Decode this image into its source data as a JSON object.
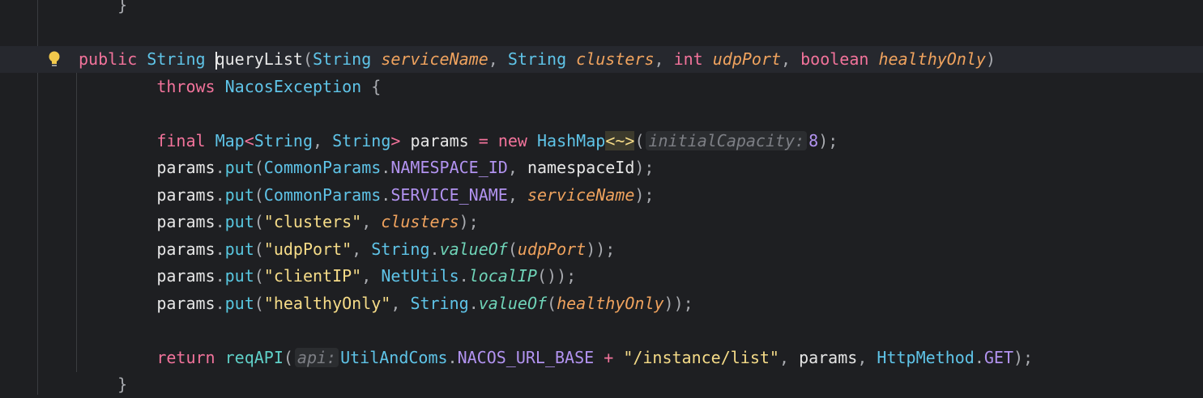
{
  "editor": {
    "language": "java",
    "colors": {
      "background": "#1e1f22",
      "current_line": "#26282e",
      "keyword": "#f2739b",
      "type": "#5fc4e8",
      "string": "#f6dc88",
      "parameter": "#f0a35e",
      "constant": "#b293f0"
    },
    "gutter_icon": "lightbulb-icon",
    "lines": [
      {
        "indent": "    ",
        "tokens": [
          {
            "t": "}",
            "c": "punct"
          }
        ]
      },
      {
        "indent": "",
        "tokens": []
      },
      {
        "indent": "",
        "current": true,
        "bulb": true,
        "tokens": [
          {
            "t": "public",
            "c": "kw"
          },
          {
            "t": " "
          },
          {
            "t": "String",
            "c": "type"
          },
          {
            "t": " "
          },
          {
            "t": "queryList",
            "c": "plain",
            "caret": true
          },
          {
            "t": "(",
            "c": "punct"
          },
          {
            "t": "String",
            "c": "type"
          },
          {
            "t": " "
          },
          {
            "t": "serviceName",
            "c": "param"
          },
          {
            "t": ", ",
            "c": "punct"
          },
          {
            "t": "String",
            "c": "type"
          },
          {
            "t": " "
          },
          {
            "t": "clusters",
            "c": "param"
          },
          {
            "t": ", ",
            "c": "punct"
          },
          {
            "t": "int",
            "c": "kw"
          },
          {
            "t": " "
          },
          {
            "t": "udpPort",
            "c": "param"
          },
          {
            "t": ", ",
            "c": "punct"
          },
          {
            "t": "boolean",
            "c": "kw"
          },
          {
            "t": " "
          },
          {
            "t": "healthyOnly",
            "c": "param"
          },
          {
            "t": ")",
            "c": "punct"
          }
        ]
      },
      {
        "indent": "        ",
        "tokens": [
          {
            "t": "throws",
            "c": "kw"
          },
          {
            "t": " "
          },
          {
            "t": "NacosException",
            "c": "type"
          },
          {
            "t": " "
          },
          {
            "t": "{",
            "c": "punct"
          }
        ]
      },
      {
        "indent": "",
        "tokens": []
      },
      {
        "indent": "        ",
        "tokens": [
          {
            "t": "final",
            "c": "kw"
          },
          {
            "t": " "
          },
          {
            "t": "Map",
            "c": "type"
          },
          {
            "t": "<",
            "c": "kw"
          },
          {
            "t": "String",
            "c": "type"
          },
          {
            "t": ", ",
            "c": "punct"
          },
          {
            "t": "String",
            "c": "type"
          },
          {
            "t": ">",
            "c": "kw"
          },
          {
            "t": " "
          },
          {
            "t": "params",
            "c": "plain"
          },
          {
            "t": " "
          },
          {
            "t": "=",
            "c": "kw"
          },
          {
            "t": " "
          },
          {
            "t": "new",
            "c": "kw"
          },
          {
            "t": " "
          },
          {
            "t": "HashMap",
            "c": "type"
          },
          {
            "t": "<~>",
            "c": "angle"
          },
          {
            "t": "(",
            "c": "punct"
          },
          {
            "t": "initialCapacity:",
            "c": "hint"
          },
          {
            "t": "8",
            "c": "num"
          },
          {
            "t": ");",
            "c": "punct"
          }
        ]
      },
      {
        "indent": "        ",
        "tokens": [
          {
            "t": "params",
            "c": "plain"
          },
          {
            "t": ".",
            "c": "punct"
          },
          {
            "t": "put",
            "c": "method"
          },
          {
            "t": "(",
            "c": "punct"
          },
          {
            "t": "CommonParams",
            "c": "type"
          },
          {
            "t": ".",
            "c": "punct"
          },
          {
            "t": "NAMESPACE_ID",
            "c": "const"
          },
          {
            "t": ", ",
            "c": "punct"
          },
          {
            "t": "namespaceId",
            "c": "plain"
          },
          {
            "t": ");",
            "c": "punct"
          }
        ]
      },
      {
        "indent": "        ",
        "tokens": [
          {
            "t": "params",
            "c": "plain"
          },
          {
            "t": ".",
            "c": "punct"
          },
          {
            "t": "put",
            "c": "method"
          },
          {
            "t": "(",
            "c": "punct"
          },
          {
            "t": "CommonParams",
            "c": "type"
          },
          {
            "t": ".",
            "c": "punct"
          },
          {
            "t": "SERVICE_NAME",
            "c": "const"
          },
          {
            "t": ", ",
            "c": "punct"
          },
          {
            "t": "serviceName",
            "c": "param"
          },
          {
            "t": ");",
            "c": "punct"
          }
        ]
      },
      {
        "indent": "        ",
        "tokens": [
          {
            "t": "params",
            "c": "plain"
          },
          {
            "t": ".",
            "c": "punct"
          },
          {
            "t": "put",
            "c": "method"
          },
          {
            "t": "(",
            "c": "punct"
          },
          {
            "t": "\"clusters\"",
            "c": "str"
          },
          {
            "t": ", ",
            "c": "punct"
          },
          {
            "t": "clusters",
            "c": "param"
          },
          {
            "t": ");",
            "c": "punct"
          }
        ]
      },
      {
        "indent": "        ",
        "tokens": [
          {
            "t": "params",
            "c": "plain"
          },
          {
            "t": ".",
            "c": "punct"
          },
          {
            "t": "put",
            "c": "method"
          },
          {
            "t": "(",
            "c": "punct"
          },
          {
            "t": "\"udpPort\"",
            "c": "str"
          },
          {
            "t": ", ",
            "c": "punct"
          },
          {
            "t": "String",
            "c": "type"
          },
          {
            "t": ".",
            "c": "punct"
          },
          {
            "t": "valueOf",
            "c": "static"
          },
          {
            "t": "(",
            "c": "punct"
          },
          {
            "t": "udpPort",
            "c": "param"
          },
          {
            "t": "));",
            "c": "punct"
          }
        ]
      },
      {
        "indent": "        ",
        "tokens": [
          {
            "t": "params",
            "c": "plain"
          },
          {
            "t": ".",
            "c": "punct"
          },
          {
            "t": "put",
            "c": "method"
          },
          {
            "t": "(",
            "c": "punct"
          },
          {
            "t": "\"clientIP\"",
            "c": "str"
          },
          {
            "t": ", ",
            "c": "punct"
          },
          {
            "t": "NetUtils",
            "c": "type"
          },
          {
            "t": ".",
            "c": "punct"
          },
          {
            "t": "localIP",
            "c": "static"
          },
          {
            "t": "());",
            "c": "punct"
          }
        ]
      },
      {
        "indent": "        ",
        "tokens": [
          {
            "t": "params",
            "c": "plain"
          },
          {
            "t": ".",
            "c": "punct"
          },
          {
            "t": "put",
            "c": "method"
          },
          {
            "t": "(",
            "c": "punct"
          },
          {
            "t": "\"healthyOnly\"",
            "c": "str"
          },
          {
            "t": ", ",
            "c": "punct"
          },
          {
            "t": "String",
            "c": "type"
          },
          {
            "t": ".",
            "c": "punct"
          },
          {
            "t": "valueOf",
            "c": "static"
          },
          {
            "t": "(",
            "c": "punct"
          },
          {
            "t": "healthyOnly",
            "c": "param"
          },
          {
            "t": "));",
            "c": "punct"
          }
        ]
      },
      {
        "indent": "",
        "tokens": []
      },
      {
        "indent": "        ",
        "tokens": [
          {
            "t": "return",
            "c": "kw"
          },
          {
            "t": " "
          },
          {
            "t": "reqAPI",
            "c": "fn"
          },
          {
            "t": "(",
            "c": "punct"
          },
          {
            "t": "api:",
            "c": "hint"
          },
          {
            "t": "UtilAndComs",
            "c": "type"
          },
          {
            "t": ".",
            "c": "punct"
          },
          {
            "t": "NACOS_URL_BASE",
            "c": "const"
          },
          {
            "t": " "
          },
          {
            "t": "+",
            "c": "kw"
          },
          {
            "t": " "
          },
          {
            "t": "\"/instance/list\"",
            "c": "str"
          },
          {
            "t": ", ",
            "c": "punct"
          },
          {
            "t": "params",
            "c": "plain"
          },
          {
            "t": ", ",
            "c": "punct"
          },
          {
            "t": "HttpMethod",
            "c": "type"
          },
          {
            "t": ".",
            "c": "punct"
          },
          {
            "t": "GET",
            "c": "const"
          },
          {
            "t": ");",
            "c": "punct"
          }
        ]
      },
      {
        "indent": "    ",
        "tokens": [
          {
            "t": "}",
            "c": "punct"
          }
        ]
      }
    ]
  }
}
